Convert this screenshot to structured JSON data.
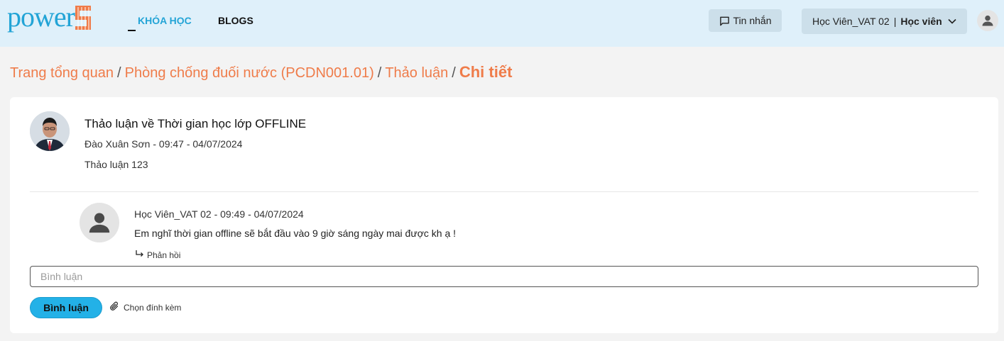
{
  "header": {
    "logo_text": "power",
    "nav": [
      {
        "label": "KHÓA HỌC",
        "active": true
      },
      {
        "label": "BLOGS",
        "active": false
      }
    ],
    "messages_label": "Tin nhắn",
    "user": {
      "name": "Học Viên_VAT 02",
      "separator": "|",
      "role": "Học viên"
    },
    "icons": {
      "messages": "chat-bubble-icon",
      "chevron": "chevron-down-icon",
      "avatar": "user-avatar-icon"
    }
  },
  "breadcrumb": {
    "items": [
      "Trang tổng quan",
      "Phòng chống đuối nước (PCDN001.01)",
      "Thảo luận"
    ],
    "separator": "/",
    "current": "Chi tiết"
  },
  "post": {
    "title": "Thảo luận về Thời gian học lớp OFFLINE",
    "meta": "Đào Xuân Sơn - 09:47 - 04/07/2024",
    "body": "Thảo luận 123"
  },
  "reply": {
    "meta": "Học Viên_VAT 02 - 09:49 - 04/07/2024",
    "body": "Em nghĩ thời gian offline sẽ bắt đầu vào 9 giờ sáng ngày mai được kh ạ !",
    "action_label": "Phản hồi",
    "action_icon": "reply-arrow-icon"
  },
  "comment": {
    "placeholder": "Bình luận",
    "value": "",
    "submit_label": "Bình luận",
    "attach_label": "Chọn đính kèm",
    "attach_icon": "paperclip-icon"
  },
  "colors": {
    "header_bg": "#dff0fa",
    "brand_blue": "#23a4d6",
    "accent_orange": "#ef7c4a",
    "button_blue": "#23b1e7",
    "logo_mark": "#ef7c4a"
  }
}
